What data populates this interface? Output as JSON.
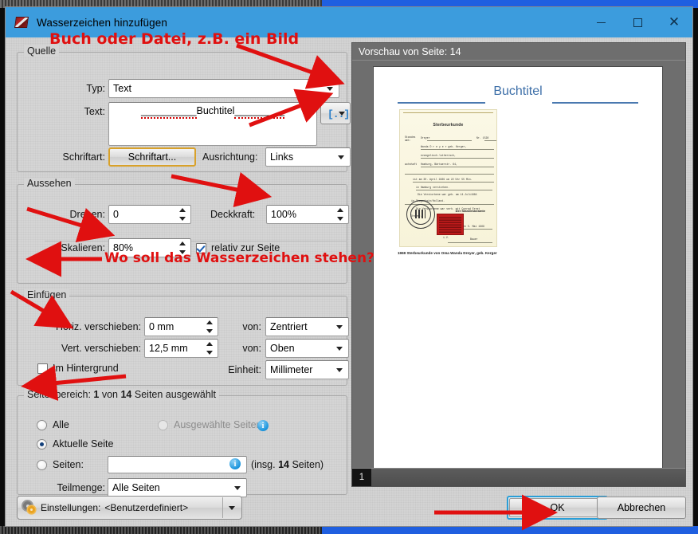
{
  "window": {
    "title": "Wasserzeichen hinzufügen",
    "icon": "watermark-pen-icon",
    "minimize": "–",
    "maximize": "□",
    "close": "✕",
    "accent_titlebar": "#3c9cdd"
  },
  "source_group": {
    "legend": "Quelle",
    "type_label": "Typ:",
    "type_value": "Text",
    "text_label": "Text:",
    "text_value_prefix": "__________",
    "text_value_word": "Buchtitel",
    "text_value_suffix": "_________",
    "insert_button_glyph": "[..]",
    "font_label": "Schriftart:",
    "font_button": "Schriftart...",
    "align_label": "Ausrichtung:",
    "align_value": "Links"
  },
  "appearance_group": {
    "legend": "Aussehen",
    "rotate_label": "Drehen:",
    "rotate_value": "0",
    "opacity_label": "Deckkraft:",
    "opacity_value": "100%",
    "scale_label": "Skalieren:",
    "scale_value": "80%",
    "relative_checkbox": "relativ zur Seite",
    "relative_checked": true
  },
  "insert_group": {
    "legend": "Einfügen",
    "horiz_label": "Horiz. verschieben:",
    "horiz_value": "0 mm",
    "horiz_from_label": "von:",
    "horiz_from_value": "Zentriert",
    "vert_label": "Vert. verschieben:",
    "vert_value": "12,5 mm",
    "vert_from_label": "von:",
    "vert_from_value": "Oben",
    "unit_label": "Einheit:",
    "unit_value": "Millimeter",
    "background_checkbox": "Im Hintergrund",
    "background_checked": false
  },
  "pagerange_group": {
    "legend_prefix": "Seitenbereich:",
    "legend_count": "1",
    "legend_mid": "von",
    "legend_total": "14",
    "legend_suffix": "Seiten ausgewählt",
    "radio_all": "Alle",
    "radio_selected": "Ausgewählte Seiten",
    "radio_selected_disabled": true,
    "radio_current": "Aktuelle Seite",
    "radio_current_selected": true,
    "radio_pages": "Seiten:",
    "pages_input_value": "",
    "pages_total_note_prefix": "(insg.",
    "pages_total_note_count": "14",
    "pages_total_note_suffix": "Seiten)",
    "subset_label": "Teilmenge:",
    "subset_value": "Alle Seiten",
    "info_icon": "info-icon"
  },
  "preview": {
    "header": "Vorschau von Seite: 14",
    "page_title": "Buchtitel",
    "certificate_title": "Sterbeurkunde",
    "certificate_lines": [
      "Nach:  Dreyer                                Nr. 1528",
      "Wanda  D r e y e r  geb. Kerger,",
      "evangelisch-lutherisch,",
      "wohnhaft Hamburg, Bärtwerstr. 64,",
      "ist am 30. April 1969 um 22 Uhr 55 Minuten",
      "in Hamburg                          verstorben.",
      "Die Verstorbene war geboren am 14.Juli1884 alter Stil",
      "in Ziegenhain/Holland.",
      "Die Verstorbene war verheiratet mit Conrad Ernst Adolf Dreyer.",
      "Hamburg, den 5. Mai 1969",
      "Der Standesbeamte",
      "i.V.  Bauer"
    ],
    "caption": "1969 Sterbeurkunde von Oma Wanda Dreyer, geb. Kerger",
    "page_badge": "1"
  },
  "footer": {
    "settings_label": "Einstellungen:",
    "settings_value": "<Benutzerdefiniert>",
    "settings_icon": "gear-icon",
    "ok_label": "OK",
    "cancel_label": "Abbrechen"
  },
  "annotations": {
    "color": "#e01010",
    "note_top": "Buch oder Datei, z.B. ein Bild",
    "note_insert": "Wo soll das Wasserzeichen stehen?"
  }
}
